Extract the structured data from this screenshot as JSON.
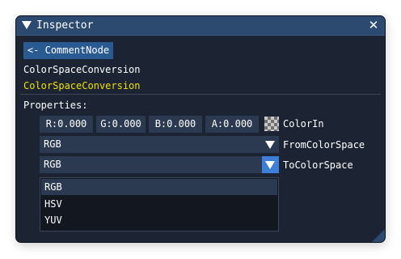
{
  "window": {
    "title": "Inspector",
    "collapse_icon": "triangle-down-icon",
    "close_icon": "close-icon",
    "close_glyph": "✕"
  },
  "node": {
    "back_button_label": "<- CommentNode",
    "type_name": "ColorSpaceConversion",
    "display_name": "ColorSpaceConversion"
  },
  "properties": {
    "label": "Properties:",
    "color_in": {
      "r": "R:0.000",
      "g": "G:0.000",
      "b": "B:0.000",
      "a": "A:0.000",
      "swatch_icon": "checkerboard-swatch",
      "label": "ColorIn"
    },
    "from_color_space": {
      "value": "RGB",
      "label": "FromColorSpace"
    },
    "to_color_space": {
      "value": "RGB",
      "label": "ToColorSpace",
      "options": [
        "RGB",
        "HSV",
        "YUV"
      ],
      "highlighted_option": "RGB"
    }
  },
  "colors": {
    "title_bar": "#2c4a70",
    "panel_bg": "#1c2433",
    "field_bg": "#2b3a50",
    "accent": "#3d7ed9",
    "highlight_text": "#f0e000"
  }
}
